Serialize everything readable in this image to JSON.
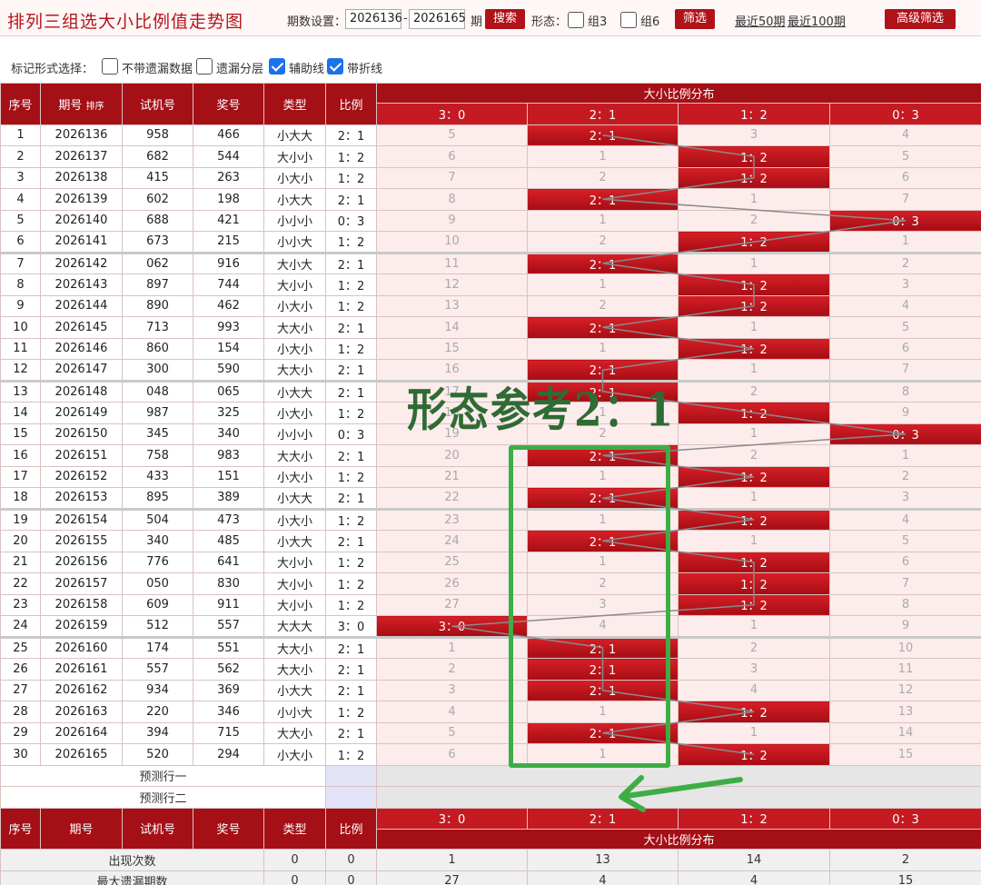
{
  "header": {
    "title": "排列三组选大小比例值走势图",
    "period_label": "期数设置：",
    "from_value": "2026136",
    "dash": "-",
    "to_value": "2026165",
    "period_unit": "期",
    "search_label": "搜索",
    "shape_label": "形态：",
    "zu3_label": "组3",
    "zu6_label": "组6",
    "filter_label": "筛选",
    "recent50_label": "最近50期",
    "recent100_label": "最近100期",
    "advanced_label": "高级筛选"
  },
  "markbar": {
    "label": "标记形式选择：",
    "opt_nomiss": "不带遗漏数据",
    "opt_layer": "遗漏分层",
    "opt_aux": "辅助线",
    "opt_fold": "带折线"
  },
  "table": {
    "col_seq": "序号",
    "col_period": "期号",
    "sort_label": "排序",
    "col_test": "试机号",
    "col_prize": "奖号",
    "col_type": "类型",
    "col_ratio": "比例",
    "dist_title": "大小比例分布",
    "dist_cols": [
      "3：0",
      "2：1",
      "1：2",
      "0：3"
    ],
    "rows": [
      {
        "seq": "1",
        "period": "2026136",
        "test": "958",
        "prize": "466",
        "type": "小大大",
        "ratio": "2：1",
        "d": [
          "5",
          "2：1",
          "3",
          "4"
        ],
        "hit": 1
      },
      {
        "seq": "2",
        "period": "2026137",
        "test": "682",
        "prize": "544",
        "type": "大小小",
        "ratio": "1：2",
        "d": [
          "6",
          "1",
          "1：2",
          "5"
        ],
        "hit": 2
      },
      {
        "seq": "3",
        "period": "2026138",
        "test": "415",
        "prize": "263",
        "type": "小大小",
        "ratio": "1：2",
        "d": [
          "7",
          "2",
          "1：2",
          "6"
        ],
        "hit": 2
      },
      {
        "seq": "4",
        "period": "2026139",
        "test": "602",
        "prize": "198",
        "type": "小大大",
        "ratio": "2：1",
        "d": [
          "8",
          "2：1",
          "1",
          "7"
        ],
        "hit": 1
      },
      {
        "seq": "5",
        "period": "2026140",
        "test": "688",
        "prize": "421",
        "type": "小小小",
        "ratio": "0：3",
        "d": [
          "9",
          "1",
          "2",
          "0：3"
        ],
        "hit": 3
      },
      {
        "seq": "6",
        "period": "2026141",
        "test": "673",
        "prize": "215",
        "type": "小小大",
        "ratio": "1：2",
        "d": [
          "10",
          "2",
          "1：2",
          "1"
        ],
        "hit": 2
      },
      {
        "seq": "7",
        "period": "2026142",
        "test": "062",
        "prize": "916",
        "type": "大小大",
        "ratio": "2：1",
        "d": [
          "11",
          "2：1",
          "1",
          "2"
        ],
        "hit": 1
      },
      {
        "seq": "8",
        "period": "2026143",
        "test": "897",
        "prize": "744",
        "type": "大小小",
        "ratio": "1：2",
        "d": [
          "12",
          "1",
          "1：2",
          "3"
        ],
        "hit": 2
      },
      {
        "seq": "9",
        "period": "2026144",
        "test": "890",
        "prize": "462",
        "type": "小大小",
        "ratio": "1：2",
        "d": [
          "13",
          "2",
          "1：2",
          "4"
        ],
        "hit": 2
      },
      {
        "seq": "10",
        "period": "2026145",
        "test": "713",
        "prize": "993",
        "type": "大大小",
        "ratio": "2：1",
        "d": [
          "14",
          "2：1",
          "1",
          "5"
        ],
        "hit": 1
      },
      {
        "seq": "11",
        "period": "2026146",
        "test": "860",
        "prize": "154",
        "type": "小大小",
        "ratio": "1：2",
        "d": [
          "15",
          "1",
          "1：2",
          "6"
        ],
        "hit": 2
      },
      {
        "seq": "12",
        "period": "2026147",
        "test": "300",
        "prize": "590",
        "type": "大大小",
        "ratio": "2：1",
        "d": [
          "16",
          "2：1",
          "1",
          "7"
        ],
        "hit": 1
      },
      {
        "seq": "13",
        "period": "2026148",
        "test": "048",
        "prize": "065",
        "type": "小大大",
        "ratio": "2：1",
        "d": [
          "17",
          "2：1",
          "2",
          "8"
        ],
        "hit": 1
      },
      {
        "seq": "14",
        "period": "2026149",
        "test": "987",
        "prize": "325",
        "type": "小大小",
        "ratio": "1：2",
        "d": [
          "18",
          "1",
          "1：2",
          "9"
        ],
        "hit": 2
      },
      {
        "seq": "15",
        "period": "2026150",
        "test": "345",
        "prize": "340",
        "type": "小小小",
        "ratio": "0：3",
        "d": [
          "19",
          "2",
          "1",
          "0：3"
        ],
        "hit": 3
      },
      {
        "seq": "16",
        "period": "2026151",
        "test": "758",
        "prize": "983",
        "type": "大大小",
        "ratio": "2：1",
        "d": [
          "20",
          "2：1",
          "2",
          "1"
        ],
        "hit": 1
      },
      {
        "seq": "17",
        "period": "2026152",
        "test": "433",
        "prize": "151",
        "type": "小大小",
        "ratio": "1：2",
        "d": [
          "21",
          "1",
          "1：2",
          "2"
        ],
        "hit": 2
      },
      {
        "seq": "18",
        "period": "2026153",
        "test": "895",
        "prize": "389",
        "type": "小大大",
        "ratio": "2：1",
        "d": [
          "22",
          "2：1",
          "1",
          "3"
        ],
        "hit": 1
      },
      {
        "seq": "19",
        "period": "2026154",
        "test": "504",
        "prize": "473",
        "type": "小大小",
        "ratio": "1：2",
        "d": [
          "23",
          "1",
          "1：2",
          "4"
        ],
        "hit": 2
      },
      {
        "seq": "20",
        "period": "2026155",
        "test": "340",
        "prize": "485",
        "type": "小大大",
        "ratio": "2：1",
        "d": [
          "24",
          "2：1",
          "1",
          "5"
        ],
        "hit": 1
      },
      {
        "seq": "21",
        "period": "2026156",
        "test": "776",
        "prize": "641",
        "type": "大小小",
        "ratio": "1：2",
        "d": [
          "25",
          "1",
          "1：2",
          "6"
        ],
        "hit": 2
      },
      {
        "seq": "22",
        "period": "2026157",
        "test": "050",
        "prize": "830",
        "type": "大小小",
        "ratio": "1：2",
        "d": [
          "26",
          "2",
          "1：2",
          "7"
        ],
        "hit": 2
      },
      {
        "seq": "23",
        "period": "2026158",
        "test": "609",
        "prize": "911",
        "type": "大小小",
        "ratio": "1：2",
        "d": [
          "27",
          "3",
          "1：2",
          "8"
        ],
        "hit": 2
      },
      {
        "seq": "24",
        "period": "2026159",
        "test": "512",
        "prize": "557",
        "type": "大大大",
        "ratio": "3：0",
        "d": [
          "3：0",
          "4",
          "1",
          "9"
        ],
        "hit": 0
      },
      {
        "seq": "25",
        "period": "2026160",
        "test": "174",
        "prize": "551",
        "type": "大大小",
        "ratio": "2：1",
        "d": [
          "1",
          "2：1",
          "2",
          "10"
        ],
        "hit": 1
      },
      {
        "seq": "26",
        "period": "2026161",
        "test": "557",
        "prize": "562",
        "type": "大大小",
        "ratio": "2：1",
        "d": [
          "2",
          "2：1",
          "3",
          "11"
        ],
        "hit": 1
      },
      {
        "seq": "27",
        "period": "2026162",
        "test": "934",
        "prize": "369",
        "type": "小大大",
        "ratio": "2：1",
        "d": [
          "3",
          "2：1",
          "4",
          "12"
        ],
        "hit": 1
      },
      {
        "seq": "28",
        "period": "2026163",
        "test": "220",
        "prize": "346",
        "type": "小小大",
        "ratio": "1：2",
        "d": [
          "4",
          "1",
          "1：2",
          "13"
        ],
        "hit": 2
      },
      {
        "seq": "29",
        "period": "2026164",
        "test": "394",
        "prize": "715",
        "type": "大大小",
        "ratio": "2：1",
        "d": [
          "5",
          "2：1",
          "1",
          "14"
        ],
        "hit": 1
      },
      {
        "seq": "30",
        "period": "2026165",
        "test": "520",
        "prize": "294",
        "type": "小大小",
        "ratio": "1：2",
        "d": [
          "6",
          "1",
          "1：2",
          "15"
        ],
        "hit": 2
      }
    ],
    "predict1": "预测行一",
    "predict2": "预测行二",
    "stats": [
      {
        "label": "出现次数",
        "type": "0",
        "ratio": "0",
        "d": [
          "1",
          "13",
          "14",
          "2"
        ]
      },
      {
        "label": "最大遗漏期数",
        "type": "0",
        "ratio": "0",
        "d": [
          "27",
          "4",
          "4",
          "15"
        ]
      }
    ]
  },
  "annotation": {
    "text": "形态参考2：1",
    "color": "#2f6b34",
    "box_color": "#3dae45"
  }
}
